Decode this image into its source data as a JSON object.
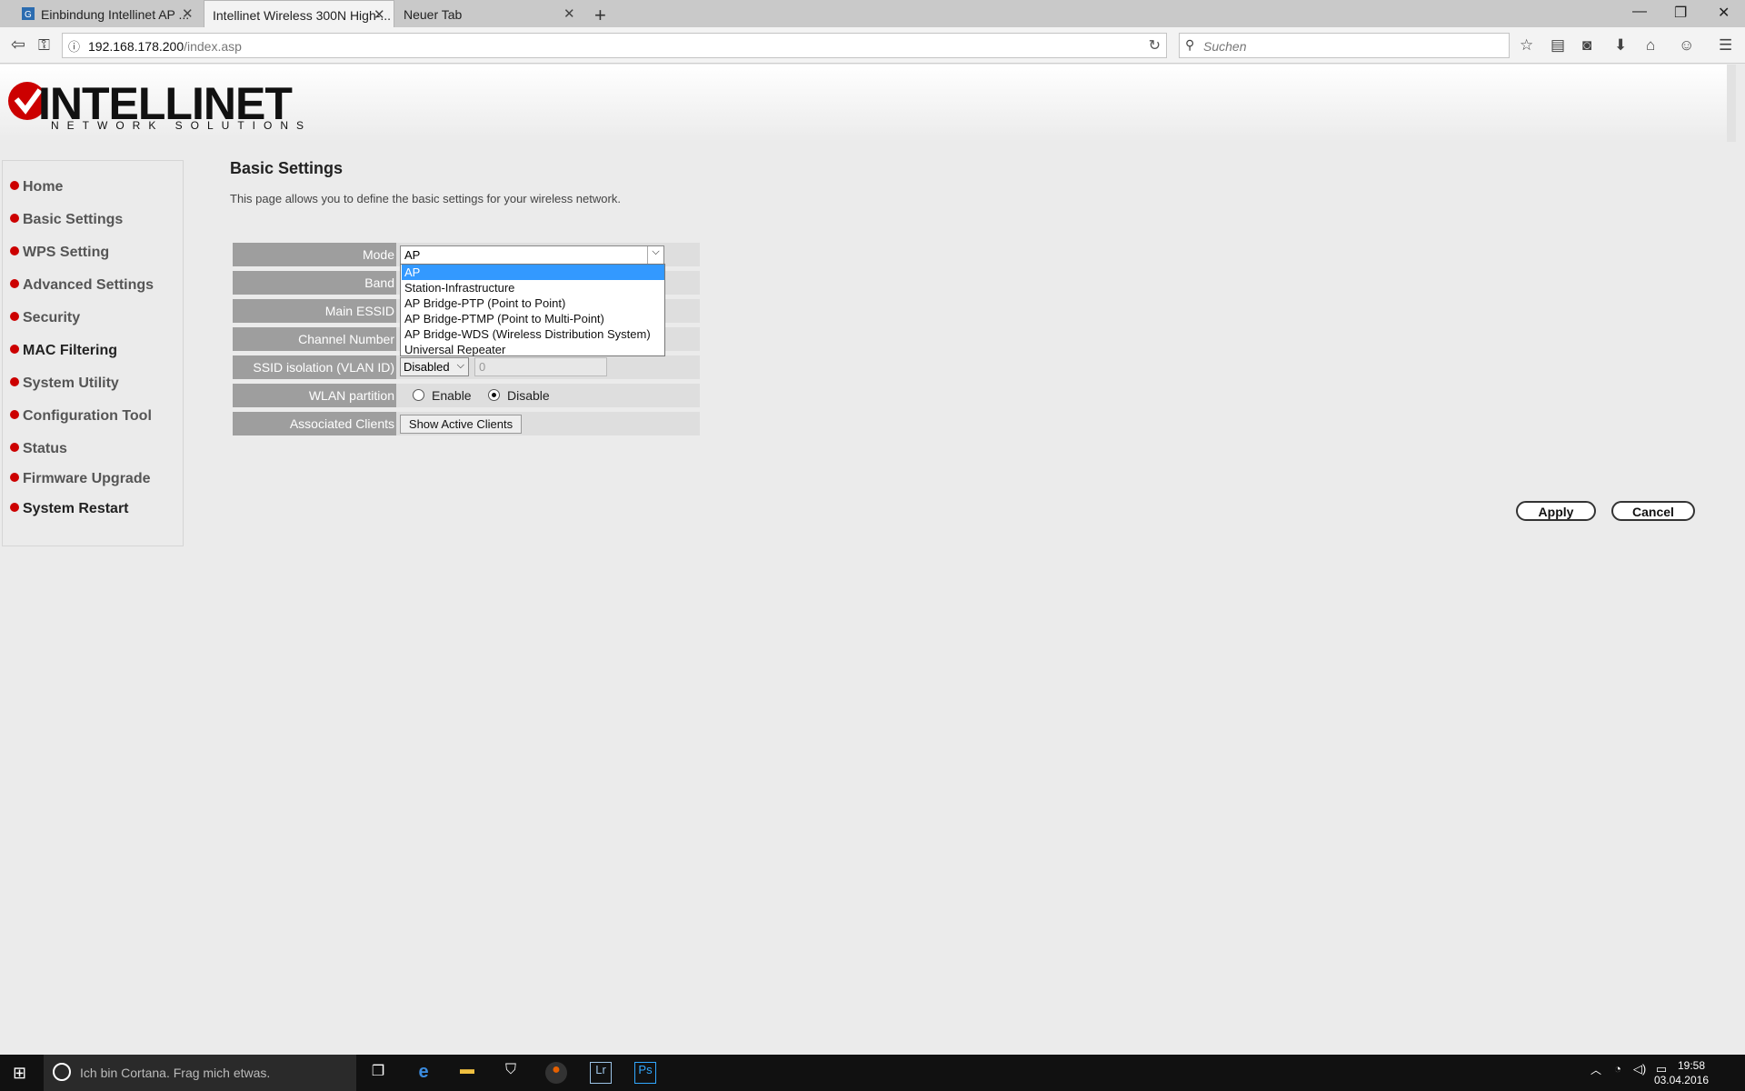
{
  "browser": {
    "tabs": [
      {
        "label": "Einbindung Intellinet AP ..."
      },
      {
        "label": "Intellinet Wireless 300N High-..."
      },
      {
        "label": "Neuer Tab"
      }
    ],
    "url_host": "192.168.178.200",
    "url_path": "/index.asp",
    "search_placeholder": "Suchen"
  },
  "logo": {
    "title": "INTELLINET",
    "subtitle": "NETWORK SOLUTIONS"
  },
  "sidebar": {
    "items": [
      {
        "label": "Home"
      },
      {
        "label": "Basic Settings"
      },
      {
        "label": "WPS Setting"
      },
      {
        "label": "Advanced Settings"
      },
      {
        "label": "Security"
      },
      {
        "label": "MAC Filtering"
      },
      {
        "label": "System Utility"
      },
      {
        "label": "Configuration Tool"
      },
      {
        "label": "Status"
      },
      {
        "label": "Firmware Upgrade"
      },
      {
        "label": "System Restart"
      }
    ]
  },
  "main": {
    "title": "Basic Settings",
    "description": "This page allows you to define the basic settings for your wireless network.",
    "rows": {
      "mode": "Mode",
      "band": "Band",
      "essid": "Main ESSID",
      "channel": "Channel Number",
      "ssid_isolation": "SSID isolation (VLAN ID)",
      "wlan_partition": "WLAN partition",
      "associated": "Associated Clients"
    },
    "mode_value": "AP",
    "mode_options": [
      "AP",
      "Station-Infrastructure",
      "AP Bridge-PTP (Point to Point)",
      "AP Bridge-PTMP (Point to Multi-Point)",
      "AP Bridge-WDS (Wireless Distribution System)",
      "Universal Repeater"
    ],
    "ssid_isolation_value": "Disabled",
    "vlan_id_value": "0",
    "wlan_enable": "Enable",
    "wlan_disable": "Disable",
    "show_clients": "Show Active Clients",
    "apply": "Apply",
    "cancel": "Cancel"
  },
  "taskbar": {
    "cortana": "Ich bin Cortana. Frag mich etwas.",
    "time": "19:58",
    "date": "03.04.2016"
  },
  "colors": {
    "highlight": "#3399ff",
    "brand": "#cc0000"
  }
}
